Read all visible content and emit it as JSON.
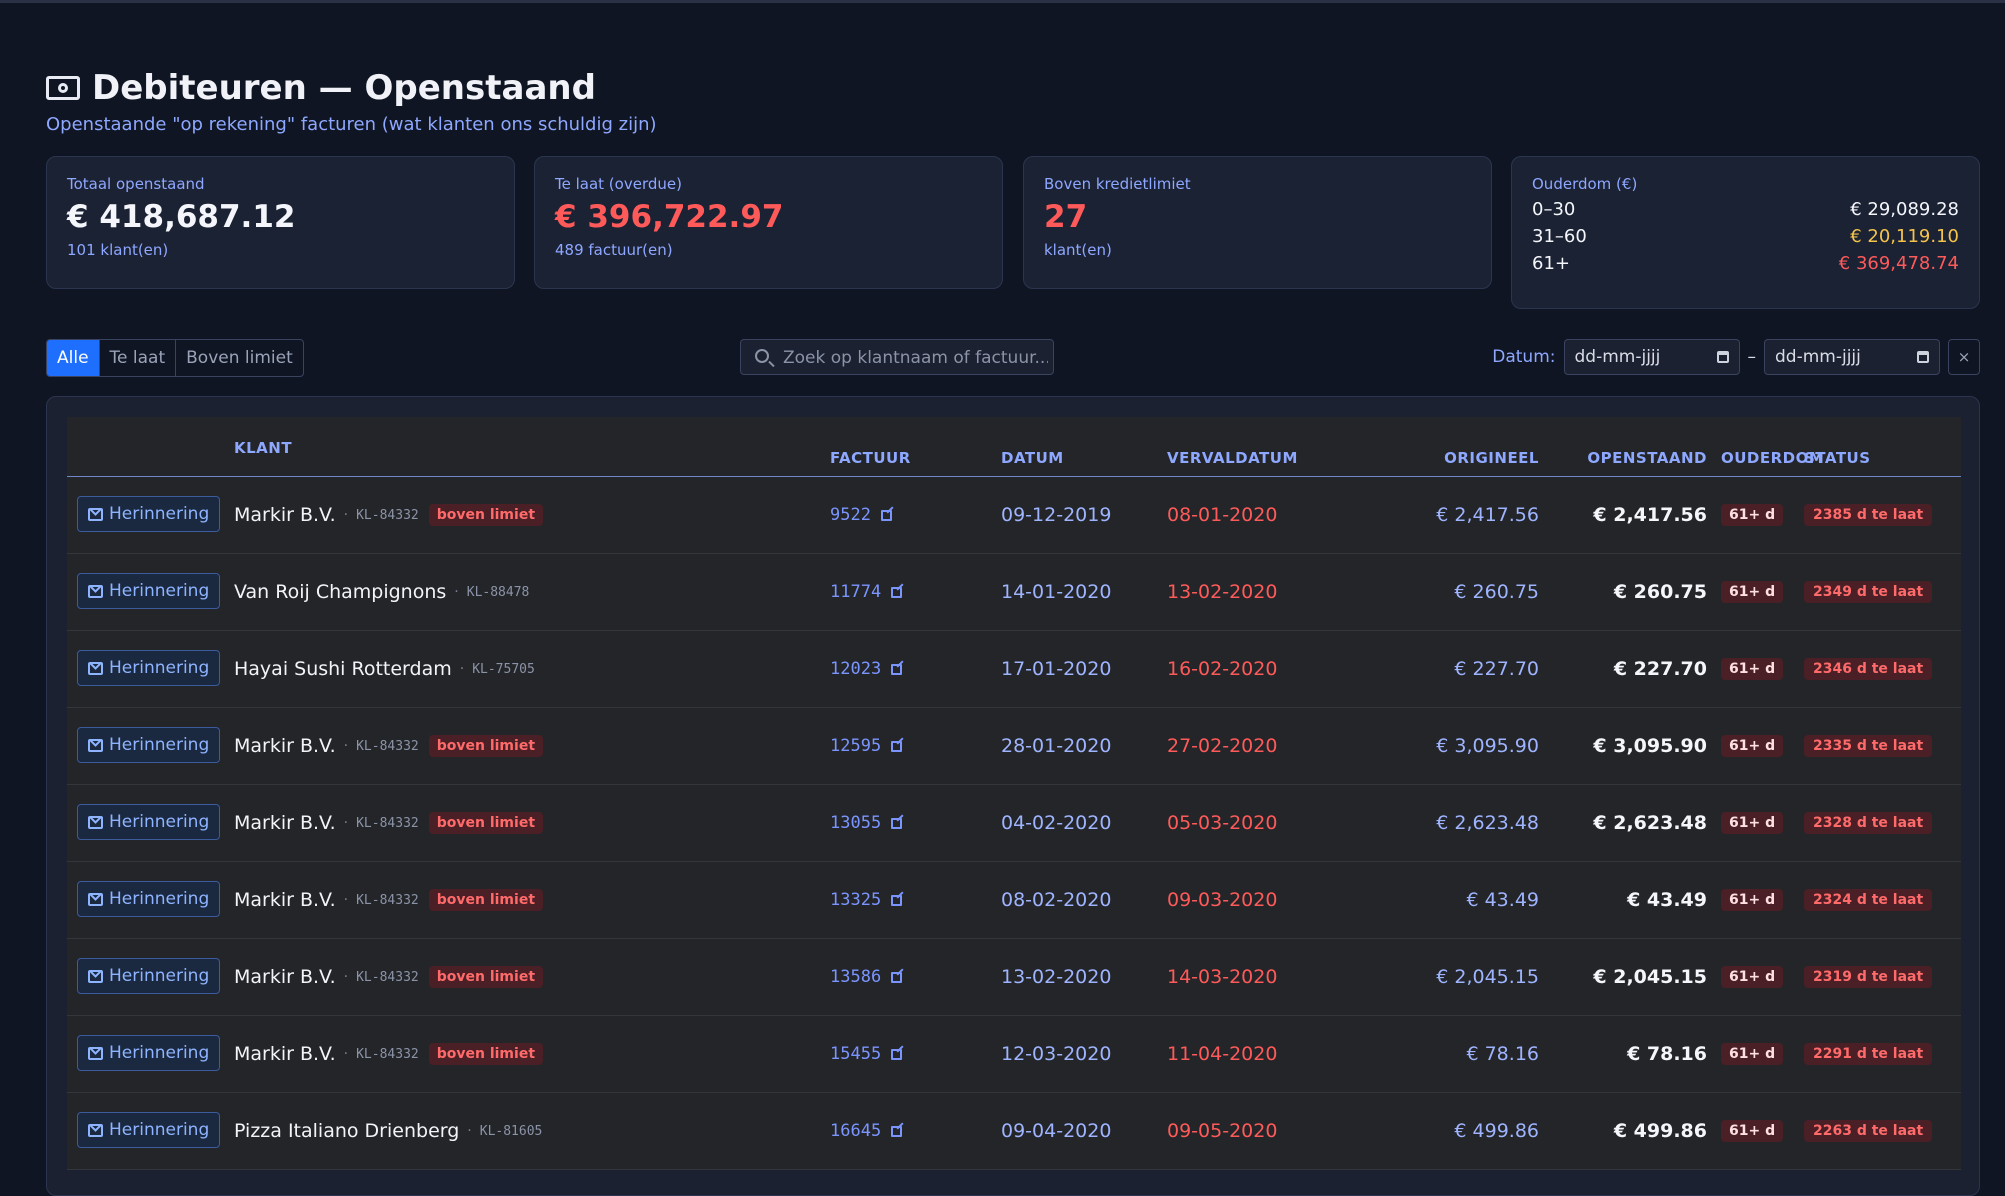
{
  "header": {
    "title": "Debiteuren — Openstaand",
    "subtitle": "Openstaande \"op rekening\" facturen (wat klanten ons schuldig zijn)"
  },
  "cards": {
    "total": {
      "label": "Totaal openstaand",
      "value": "€ 418,687.12",
      "sub": "101 klant(en)"
    },
    "overdue": {
      "label": "Te laat (overdue)",
      "value": "€ 396,722.97",
      "sub": "489 factuur(en)"
    },
    "limit": {
      "label": "Boven kredietlimiet",
      "value": "27",
      "sub": "klant(en)"
    },
    "aging": {
      "label": "Ouderdom (€)",
      "rows": [
        {
          "label": "0–30",
          "value": "€ 29,089.28",
          "color": "#f4f6fb"
        },
        {
          "label": "31–60",
          "value": "€ 20,119.10",
          "color": "#f5c34a"
        },
        {
          "label": "61+",
          "value": "€ 369,478.74",
          "color": "#ff5a5a"
        }
      ]
    }
  },
  "filters": {
    "tabs": [
      "Alle",
      "Te laat",
      "Boven limiet"
    ],
    "search_placeholder": "Zoek op klantnaam of factuur...",
    "date_label": "Datum:",
    "date_from": "dd-mm-jjjj",
    "date_sep": "–",
    "date_to": "dd-mm-jjjj",
    "clear": "×"
  },
  "table": {
    "columns": {
      "klant": "KLANT",
      "factuur": "FACTUUR",
      "datum": "DATUM",
      "vervaldatum": "VERVALDATUM",
      "origineel": "ORIGINEEL",
      "openstaand": "OPENSTAAND",
      "ouderdom": "OUDERDOM",
      "status": "STATUS"
    },
    "remind_label": "Herinnering",
    "limit_badge": "boven limiet",
    "rows": [
      {
        "name": "Markir B.V.",
        "code": "KL-84332",
        "limit": true,
        "invoice": "9522",
        "date": "09-12-2019",
        "due": "08-01-2020",
        "orig": "€ 2,417.56",
        "open": "€ 2,417.56",
        "age": "61+ d",
        "status": "2385 d te laat"
      },
      {
        "name": "Van Roij Champignons",
        "code": "KL-88478",
        "limit": false,
        "invoice": "11774",
        "date": "14-01-2020",
        "due": "13-02-2020",
        "orig": "€ 260.75",
        "open": "€ 260.75",
        "age": "61+ d",
        "status": "2349 d te laat"
      },
      {
        "name": "Hayai Sushi Rotterdam",
        "code": "KL-75705",
        "limit": false,
        "invoice": "12023",
        "date": "17-01-2020",
        "due": "16-02-2020",
        "orig": "€ 227.70",
        "open": "€ 227.70",
        "age": "61+ d",
        "status": "2346 d te laat"
      },
      {
        "name": "Markir B.V.",
        "code": "KL-84332",
        "limit": true,
        "invoice": "12595",
        "date": "28-01-2020",
        "due": "27-02-2020",
        "orig": "€ 3,095.90",
        "open": "€ 3,095.90",
        "age": "61+ d",
        "status": "2335 d te laat"
      },
      {
        "name": "Markir B.V.",
        "code": "KL-84332",
        "limit": true,
        "invoice": "13055",
        "date": "04-02-2020",
        "due": "05-03-2020",
        "orig": "€ 2,623.48",
        "open": "€ 2,623.48",
        "age": "61+ d",
        "status": "2328 d te laat"
      },
      {
        "name": "Markir B.V.",
        "code": "KL-84332",
        "limit": true,
        "invoice": "13325",
        "date": "08-02-2020",
        "due": "09-03-2020",
        "orig": "€ 43.49",
        "open": "€ 43.49",
        "age": "61+ d",
        "status": "2324 d te laat"
      },
      {
        "name": "Markir B.V.",
        "code": "KL-84332",
        "limit": true,
        "invoice": "13586",
        "date": "13-02-2020",
        "due": "14-03-2020",
        "orig": "€ 2,045.15",
        "open": "€ 2,045.15",
        "age": "61+ d",
        "status": "2319 d te laat"
      },
      {
        "name": "Markir B.V.",
        "code": "KL-84332",
        "limit": true,
        "invoice": "15455",
        "date": "12-03-2020",
        "due": "11-04-2020",
        "orig": "€ 78.16",
        "open": "€ 78.16",
        "age": "61+ d",
        "status": "2291 d te laat"
      },
      {
        "name": "Pizza Italiano Drienberg",
        "code": "KL-81605",
        "limit": false,
        "invoice": "16645",
        "date": "09-04-2020",
        "due": "09-05-2020",
        "orig": "€ 499.86",
        "open": "€ 499.86",
        "age": "61+ d",
        "status": "2263 d te laat"
      }
    ]
  }
}
